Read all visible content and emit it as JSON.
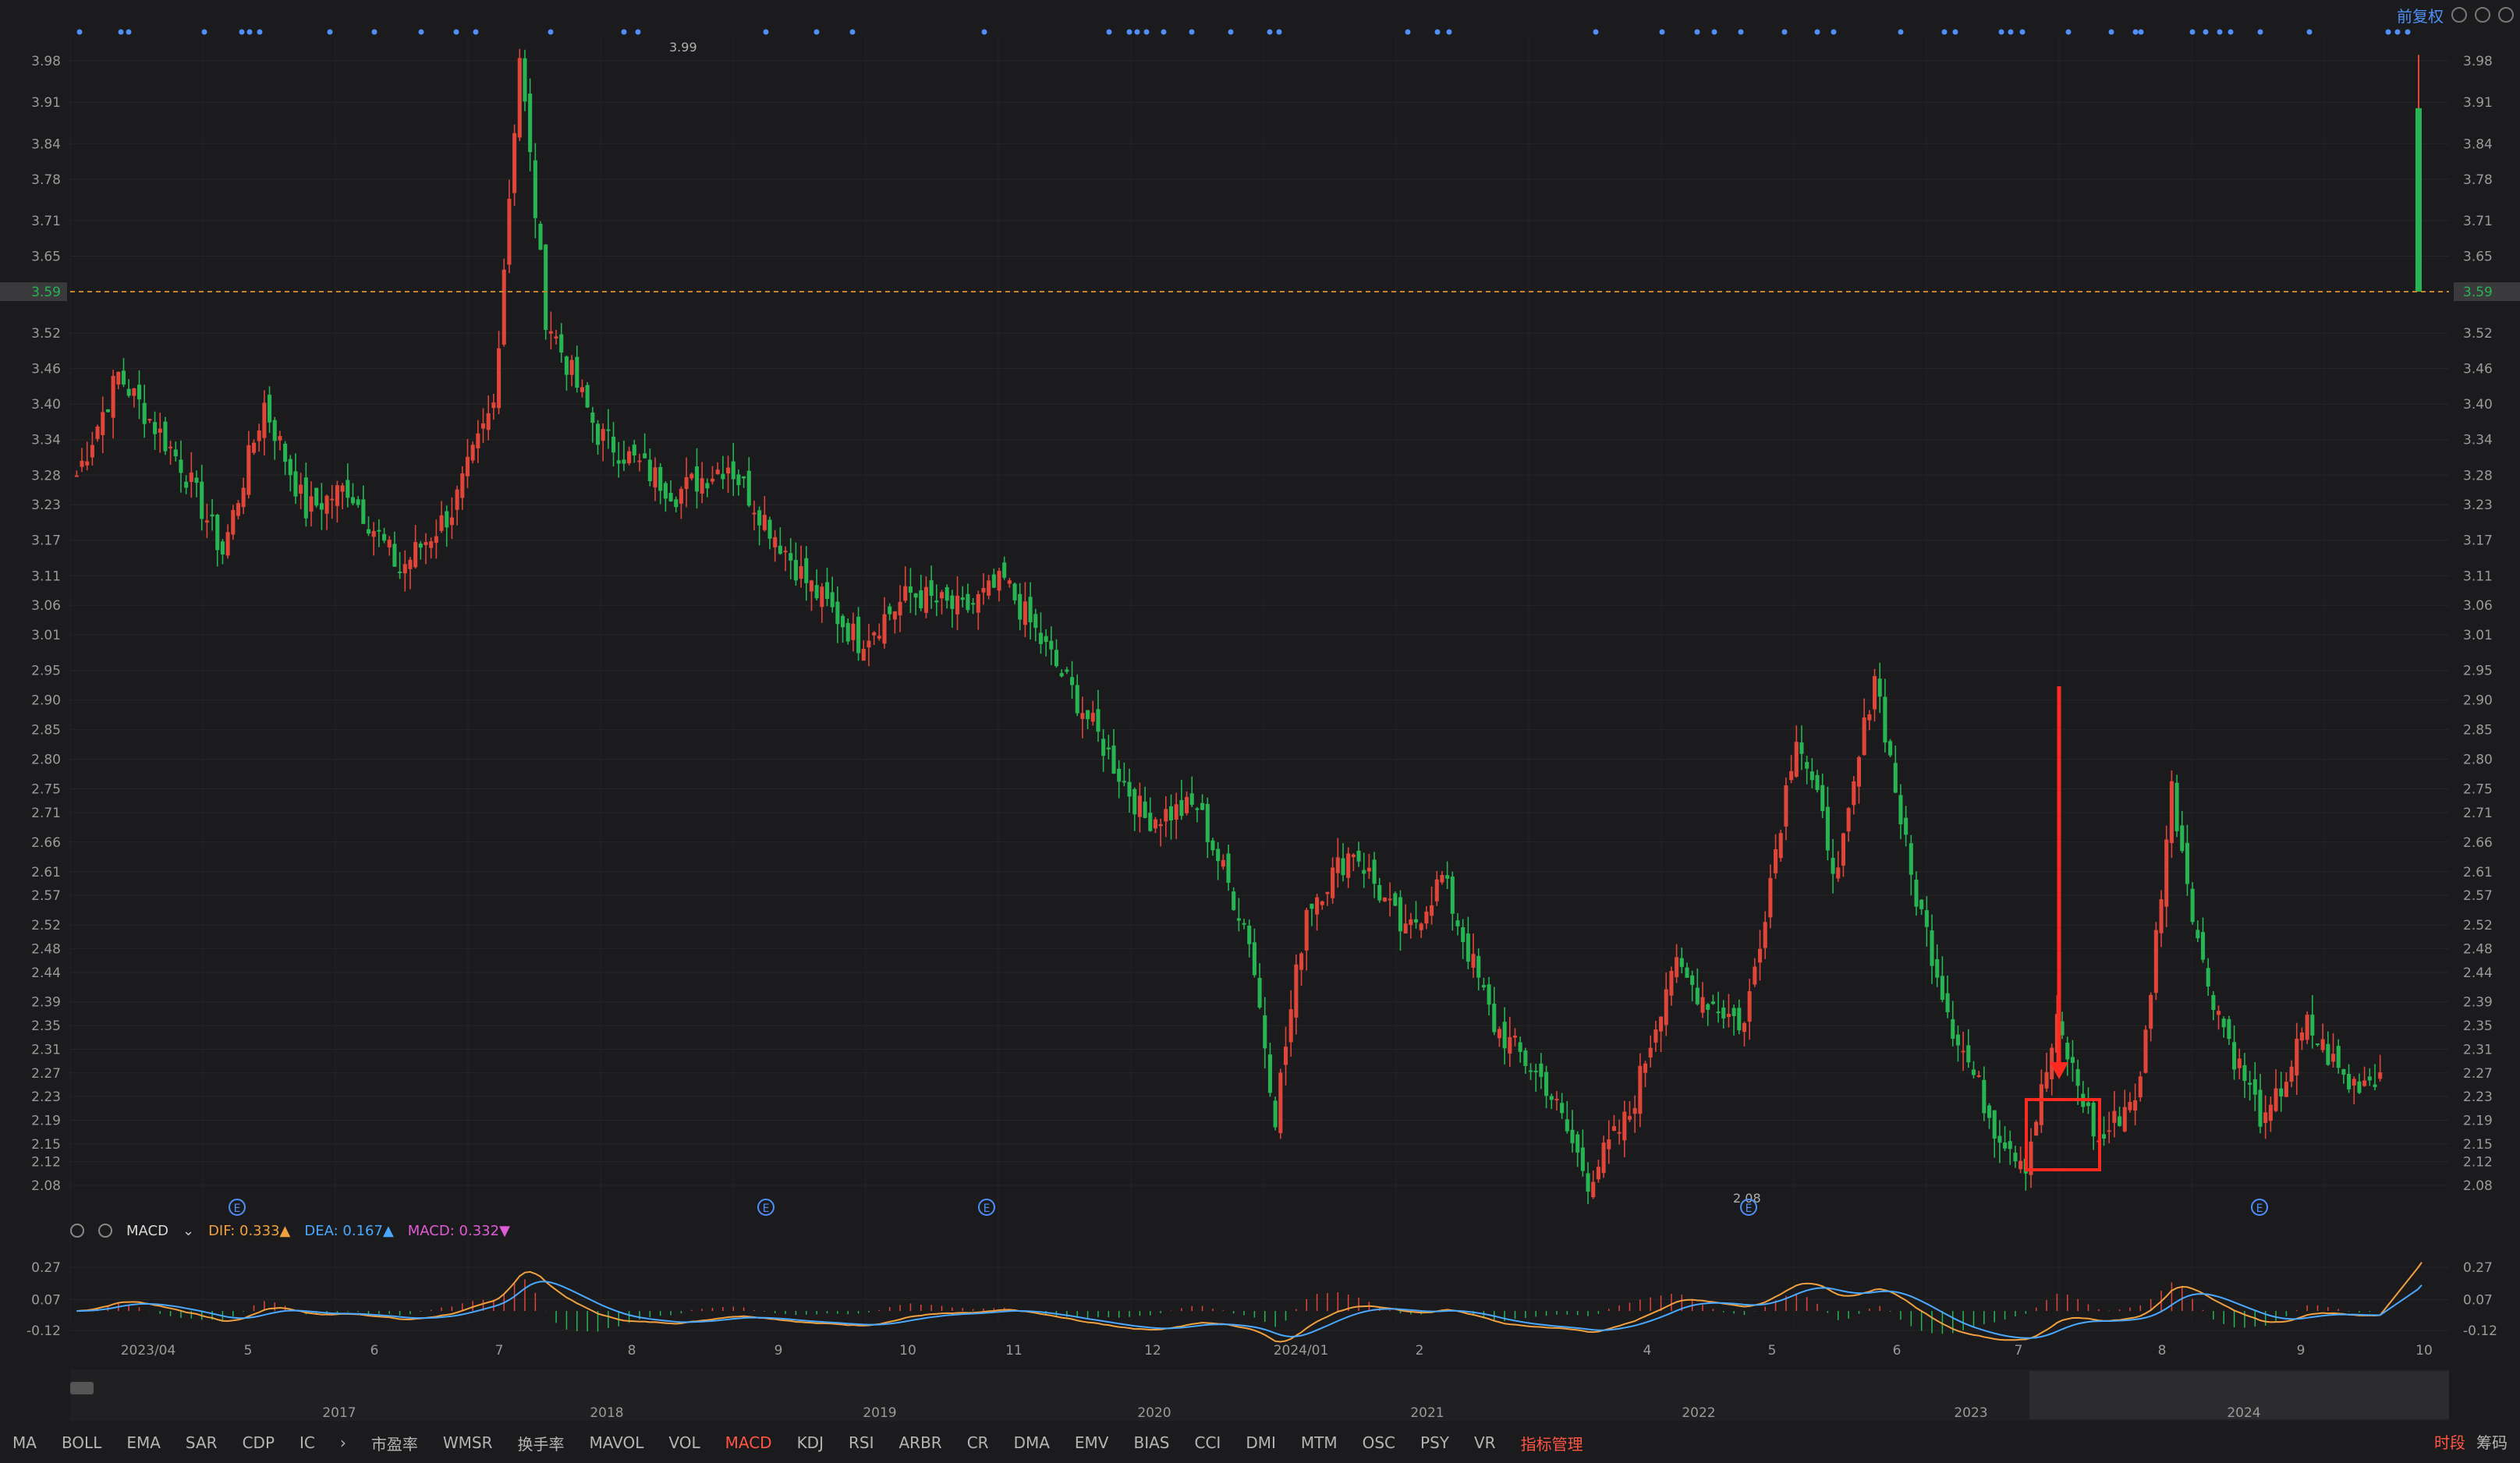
{
  "toolbar": {
    "adjust_label": "前复权"
  },
  "price_axis": {
    "ticks": [
      "3.98",
      "3.91",
      "3.84",
      "3.78",
      "3.71",
      "3.65",
      "3.59",
      "3.52",
      "3.46",
      "3.40",
      "3.34",
      "3.28",
      "3.23",
      "3.17",
      "3.11",
      "3.06",
      "3.01",
      "2.95",
      "2.90",
      "2.85",
      "2.80",
      "2.75",
      "2.71",
      "2.66",
      "2.61",
      "2.57",
      "2.52",
      "2.48",
      "2.44",
      "2.39",
      "2.35",
      "2.31",
      "2.27",
      "2.23",
      "2.19",
      "2.15",
      "2.12",
      "2.08"
    ],
    "current_price": "3.59",
    "current_price_value": 3.59,
    "high_marker": "3.99",
    "low_marker": "2.08"
  },
  "time_axis": [
    "2023/04",
    "5",
    "6",
    "7",
    "8",
    "9",
    "10",
    "11",
    "12",
    "2024/01",
    "2",
    "4",
    "5",
    "6",
    "7",
    "8",
    "9",
    "10"
  ],
  "macd": {
    "name": "MACD",
    "dif_label": "DIF:",
    "dif_value": "0.333",
    "dea_label": "DEA:",
    "dea_value": "0.167",
    "macd_label": "MACD:",
    "macd_value": "0.332",
    "ticks": [
      "0.27",
      "0.07",
      "-0.12"
    ]
  },
  "navigator": {
    "years": [
      "2017",
      "2018",
      "2019",
      "2020",
      "2021",
      "2022",
      "2023",
      "2024"
    ]
  },
  "tabs": [
    "MA",
    "BOLL",
    "EMA",
    "SAR",
    "CDP",
    "IC",
    "市盈率",
    "WMSR",
    "换手率",
    "MAVOL",
    "VOL",
    "MACD",
    "KDJ",
    "RSI",
    "ARBR",
    "CR",
    "DMA",
    "EMV",
    "BIAS",
    "CCI",
    "DMI",
    "MTM",
    "OSC",
    "PSY",
    "VR"
  ],
  "active_tab": "MACD",
  "manage_tab": "指标管理",
  "right_tabs": [
    "时段",
    "筹码"
  ],
  "colors": {
    "up": "#e0453a",
    "down": "#26b552",
    "background": "#1b1b1d",
    "price_line": "#c9822f",
    "annotation": "#ff2a1f",
    "dif": "#f0a040",
    "dea": "#4aa8ff",
    "macd": "#e05bd8",
    "nav_dot": "#4f8ff7"
  },
  "chart_data": {
    "type": "candlestick",
    "x_axis": "date (2023/04 – 2024/10)",
    "y_range": [
      2.05,
      4.0
    ],
    "keypoints": [
      [
        0,
        3.28
      ],
      [
        8,
        3.45
      ],
      [
        20,
        3.3
      ],
      [
        28,
        3.15
      ],
      [
        36,
        3.4
      ],
      [
        44,
        3.22
      ],
      [
        52,
        3.26
      ],
      [
        62,
        3.12
      ],
      [
        72,
        3.22
      ],
      [
        80,
        3.4
      ],
      [
        85,
        3.99
      ],
      [
        90,
        3.55
      ],
      [
        100,
        3.35
      ],
      [
        115,
        3.25
      ],
      [
        125,
        3.3
      ],
      [
        140,
        3.1
      ],
      [
        150,
        3.0
      ],
      [
        160,
        3.08
      ],
      [
        170,
        3.05
      ],
      [
        178,
        3.1
      ],
      [
        192,
        2.9
      ],
      [
        205,
        2.7
      ],
      [
        215,
        2.72
      ],
      [
        225,
        2.5
      ],
      [
        230,
        2.2
      ],
      [
        236,
        2.55
      ],
      [
        245,
        2.65
      ],
      [
        255,
        2.5
      ],
      [
        262,
        2.6
      ],
      [
        272,
        2.35
      ],
      [
        282,
        2.25
      ],
      [
        290,
        2.09
      ],
      [
        298,
        2.2
      ],
      [
        306,
        2.45
      ],
      [
        312,
        2.4
      ],
      [
        320,
        2.35
      ],
      [
        330,
        2.85
      ],
      [
        338,
        2.6
      ],
      [
        345,
        2.95
      ],
      [
        352,
        2.6
      ],
      [
        360,
        2.35
      ],
      [
        368,
        2.18
      ],
      [
        374,
        2.12
      ],
      [
        380,
        2.35
      ],
      [
        388,
        2.15
      ],
      [
        396,
        2.25
      ],
      [
        402,
        2.75
      ],
      [
        408,
        2.45
      ],
      [
        414,
        2.3
      ],
      [
        420,
        2.18
      ],
      [
        428,
        2.35
      ],
      [
        436,
        2.25
      ],
      [
        442,
        2.27
      ]
    ],
    "last_bar": {
      "open": 3.59,
      "high": 3.99,
      "low": 3.59,
      "close": 3.9
    },
    "markers": {
      "high": 3.99,
      "low": 2.08
    }
  }
}
